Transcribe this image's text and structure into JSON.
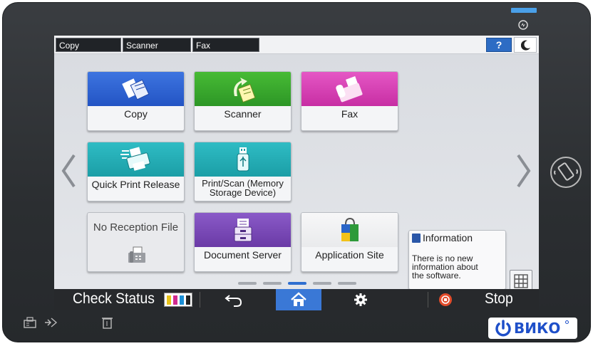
{
  "tabs": [
    "Copy",
    "Scanner",
    "Fax"
  ],
  "header": {
    "help_label": "?"
  },
  "apps": {
    "copy": "Copy",
    "scanner": "Scanner",
    "fax": "Fax",
    "quick_print": "Quick Print Release",
    "print_scan_line1": "Print/Scan (Memory",
    "print_scan_line2": "Storage Device)",
    "no_reception": "No Reception File",
    "document_server": "Document Server",
    "application_site": "Application Site"
  },
  "info": {
    "title": "Information",
    "line1": "There is no new",
    "line2": "information about",
    "line3": "the software."
  },
  "bottombar": {
    "check_status": "Check Status",
    "stop": "Stop"
  },
  "page_indicator": {
    "count": 5,
    "current": 3
  },
  "colors": {
    "copy": "#2a5fd1",
    "scanner": "#34a52a",
    "fax": "#d43db0",
    "quick_print": "#1ea8b0",
    "print_scan": "#1ea8b0",
    "document_server": "#7446b3",
    "home": "#3a78d6",
    "help": "#2d6cc4"
  },
  "icons": {
    "copy": "copy-documents-icon",
    "scanner": "scanner-icon",
    "fax": "fax-machine-icon",
    "quick_print": "printer-icon",
    "print_scan": "usb-drive-icon",
    "no_reception": "fax-tray-icon",
    "document_server": "document-server-icon",
    "application_site": "shopping-bag-icon",
    "info": "book-icon",
    "grid": "app-grid-icon",
    "back": "back-arrow-icon",
    "home": "home-icon",
    "settings": "gear-icon",
    "stop": "stop-icon"
  },
  "logo": {
    "text": "ВИКО"
  }
}
